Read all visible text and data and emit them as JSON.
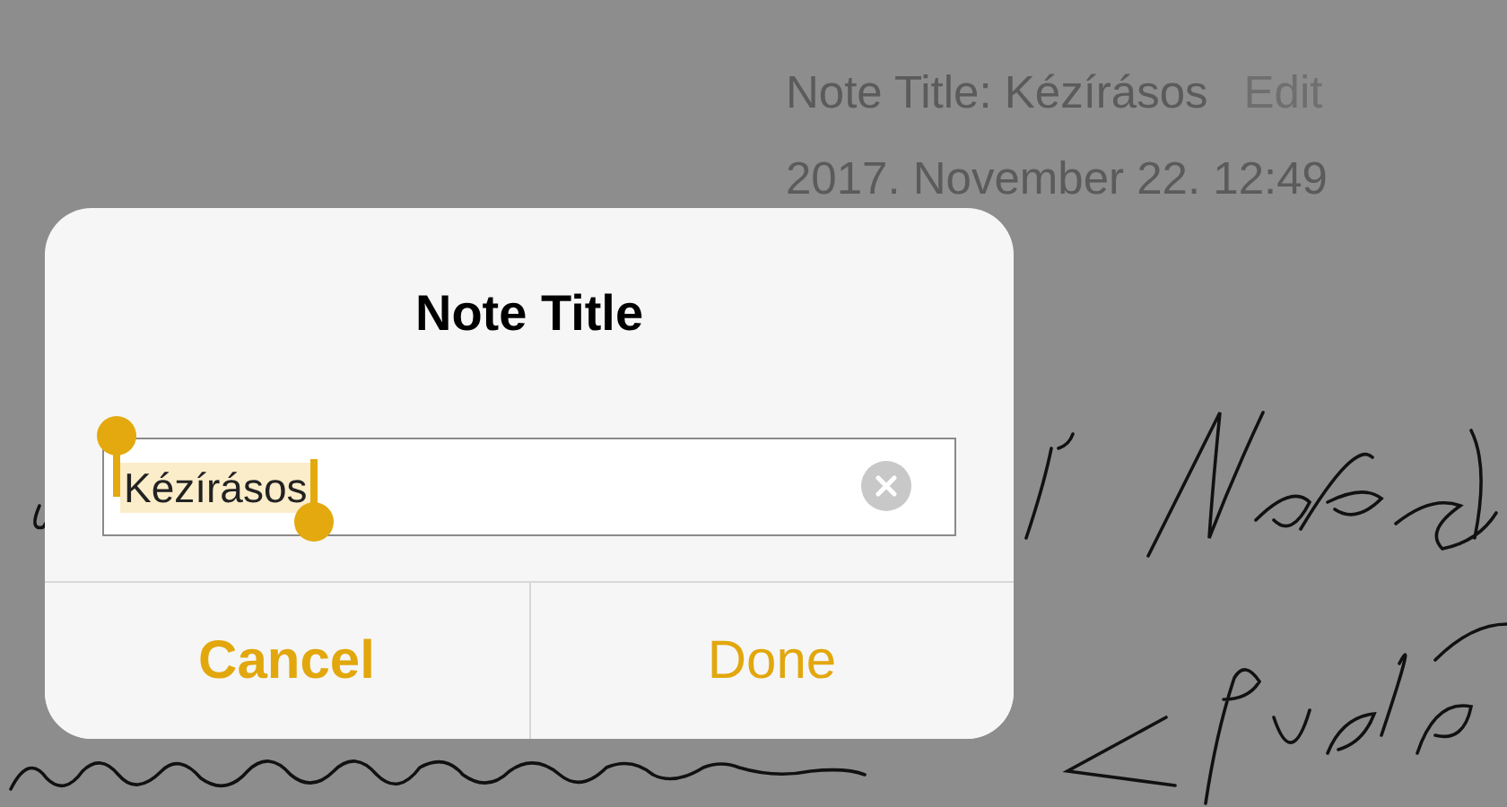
{
  "note": {
    "title": "Note Title: Kézírásos",
    "edit": "Edit",
    "date": "2017. November 22. 12:49"
  },
  "dialog": {
    "title": "Note Title",
    "field": {
      "value": "Kézírásos",
      "selected": true
    },
    "buttons": [
      {
        "label": "Cancel",
        "emphasized": true
      },
      {
        "label": "Done",
        "emphasized": false
      }
    ]
  }
}
